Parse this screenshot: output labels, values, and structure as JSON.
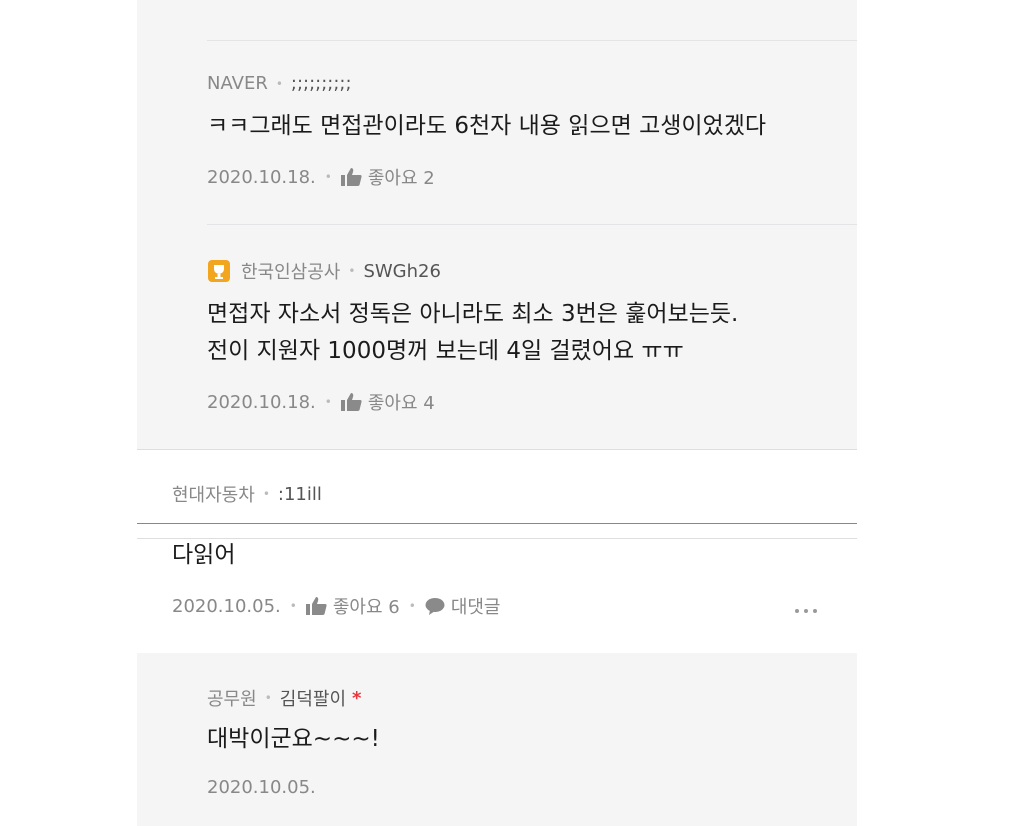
{
  "replies": [
    {
      "company": "NAVER",
      "nickname": ";;;;;;;;;;",
      "text": "ㅋㅋ그래도 면접관이라도 6천자 내용 읽으면 고생이었겠다",
      "date": "2020.10.18.",
      "like_label": "좋아요 2"
    },
    {
      "company": "한국인삼공사",
      "nickname": "SWGh26",
      "text_line1": "면접자 자소서 정독은 아니라도 최소 3번은 훑어보는듯.",
      "text_line2": "전이 지원자 1000명꺼 보는데 4일 걸렸어요 ㅠㅠ",
      "date": "2020.10.18.",
      "like_label": "좋아요 4",
      "badge_color": "#f2a51e"
    }
  ],
  "comment": {
    "company": "현대자동차",
    "nickname": ":11ill",
    "text": "다읽어",
    "date": "2020.10.05.",
    "like_label": "좋아요 6",
    "reply_label": "대댓글"
  },
  "sub_reply": {
    "company": "공무원",
    "nickname": "김덕팔이",
    "author_mark": "*",
    "text": "대박이군요~~~!",
    "date": "2020.10.05."
  }
}
